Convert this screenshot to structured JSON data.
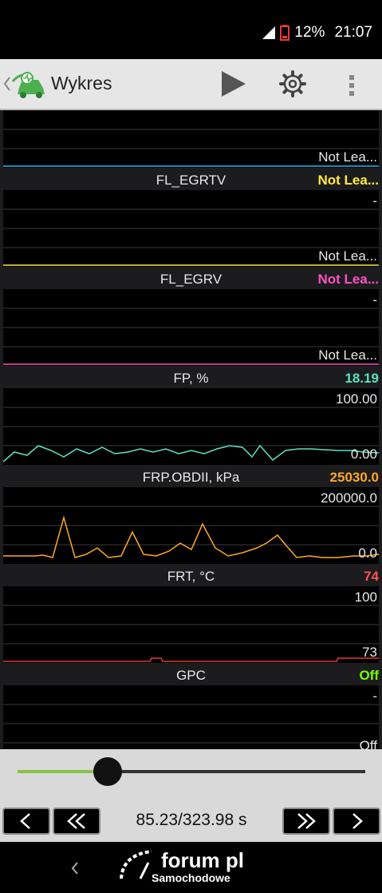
{
  "status_bar": {
    "battery": "12%",
    "time": "21:07"
  },
  "app_bar": {
    "title": "Wykres"
  },
  "charts": [
    {
      "name": "",
      "value": "",
      "y_top": "",
      "y_bottom": "Not Lea...",
      "line_color": "#29b6f6"
    },
    {
      "name": "FL_EGRTV",
      "value": "Not Lea...",
      "value_color": "#ffeb3b",
      "y_top": "-",
      "y_bottom": "Not Lea...",
      "line_color": "#ffeb3b"
    },
    {
      "name": "FL_EGRV",
      "value": "Not Lea...",
      "value_color": "#ff4fc4",
      "y_top": "-",
      "y_bottom": "Not Lea...",
      "line_color": "#ff4fc4"
    },
    {
      "name": "FP, %",
      "value": "18.19",
      "value_color": "#5ee0c0",
      "y_top": "100.00",
      "y_bottom": "0.00",
      "line_color": "#5ee0c0"
    },
    {
      "name": "FRP.OBDII, kPa",
      "value": "25030.0",
      "value_color": "#ffa726",
      "y_top": "200000.0",
      "y_bottom": "0.0",
      "line_color": "#ffa726"
    },
    {
      "name": "FRT, °C",
      "value": "74",
      "value_color": "#ff5252",
      "y_top": "100",
      "y_bottom": "73",
      "line_color": "#e53935"
    },
    {
      "name": "GPC",
      "value": "Off",
      "value_color": "#76ff03",
      "y_top": "-",
      "y_bottom": "Off",
      "line_color": "#76ff03"
    }
  ],
  "playback": {
    "position": "85.23/323.98 s",
    "progress": 0.26
  },
  "watermark": {
    "brand": "forum pl",
    "sub": "Samochodowe"
  },
  "colors": {
    "accent": "#4caf50",
    "slider_fill": "#8bc34a"
  }
}
